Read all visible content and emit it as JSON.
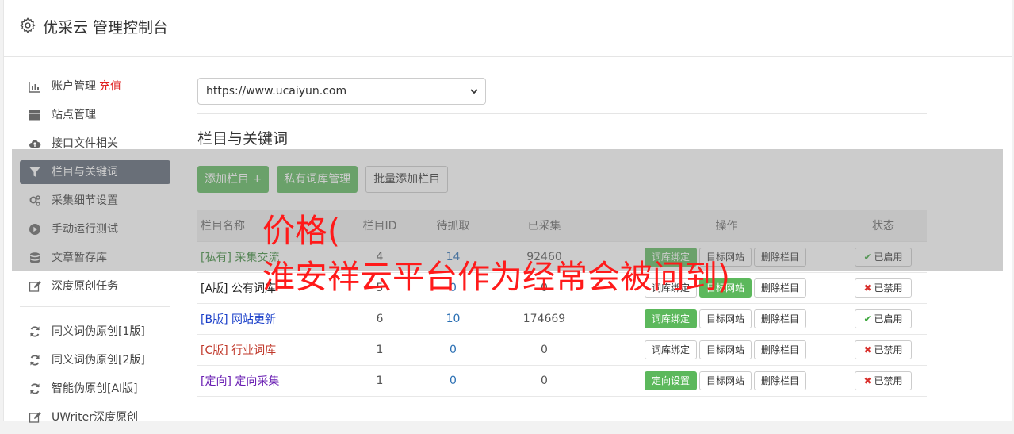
{
  "header": {
    "title": "优采云 管理控制台"
  },
  "sidebar": {
    "items": [
      {
        "label": "账户管理",
        "extra": "充值",
        "icon": "bar-chart-icon"
      },
      {
        "label": "站点管理",
        "icon": "server-icon"
      },
      {
        "label": "接口文件相关",
        "icon": "cloud-upload-icon"
      },
      {
        "label": "栏目与关键词",
        "icon": "filter-icon",
        "active": true
      },
      {
        "label": "采集细节设置",
        "icon": "cogs-icon"
      },
      {
        "label": "手动运行测试",
        "icon": "play-circle-icon"
      },
      {
        "label": "文章暂存库",
        "icon": "database-icon"
      },
      {
        "label": "深度原创任务",
        "icon": "edit-icon"
      }
    ],
    "items2": [
      {
        "label": "同义词伪原创[1版]",
        "icon": "refresh-icon"
      },
      {
        "label": "同义词伪原创[2版]",
        "icon": "refresh-icon"
      },
      {
        "label": "智能伪原创[AI版]",
        "icon": "refresh-icon"
      },
      {
        "label": "UWriter深度原创",
        "icon": "edit-icon"
      }
    ]
  },
  "site_select": {
    "value": "https://www.ucaiyun.com"
  },
  "section": {
    "title": "栏目与关键词"
  },
  "toolbar": {
    "add_column": "添加栏目 +",
    "private_lexicon": "私有词库管理",
    "batch_add": "批量添加栏目"
  },
  "table": {
    "headers": [
      "栏目名称",
      "栏目ID",
      "待抓取",
      "已采集",
      "操作",
      "状态"
    ],
    "rows": [
      {
        "tag": "[私有]",
        "name": "采集交流",
        "id": "4",
        "pending": "14",
        "collected": "92460",
        "op1": "词库绑定",
        "op2": "目标网站",
        "op3": "删除栏目",
        "status": "已启用"
      },
      {
        "tag": "[A版]",
        "name": "公有词库",
        "id": "5",
        "pending": "0",
        "collected": "0",
        "op1": "词库绑定",
        "op2": "目标网站",
        "op3": "删除栏目",
        "status": "已禁用"
      },
      {
        "tag": "[B版]",
        "name": "网站更新",
        "id": "6",
        "pending": "10",
        "collected": "174669",
        "op1": "词库绑定",
        "op2": "目标网站",
        "op3": "删除栏目",
        "status": "已启用"
      },
      {
        "tag": "[C版]",
        "name": "行业词库",
        "id": "1",
        "pending": "0",
        "collected": "0",
        "op1": "词库绑定",
        "op2": "目标网站",
        "op3": "删除栏目",
        "status": "已禁用"
      },
      {
        "tag": "[定向]",
        "name": "定向采集",
        "id": "1",
        "pending": "0",
        "collected": "0",
        "op1": "定向设置",
        "op2": "目标网站",
        "op3": "删除栏目",
        "status": "已禁用"
      }
    ]
  },
  "overlay": {
    "line1": "价格(",
    "line2": "淮安祥云平台作为经常会被问到)"
  },
  "colors": {
    "accent_green": "#5cb85c",
    "sidebar_active": "#5a6474",
    "danger": "#d9302c"
  }
}
